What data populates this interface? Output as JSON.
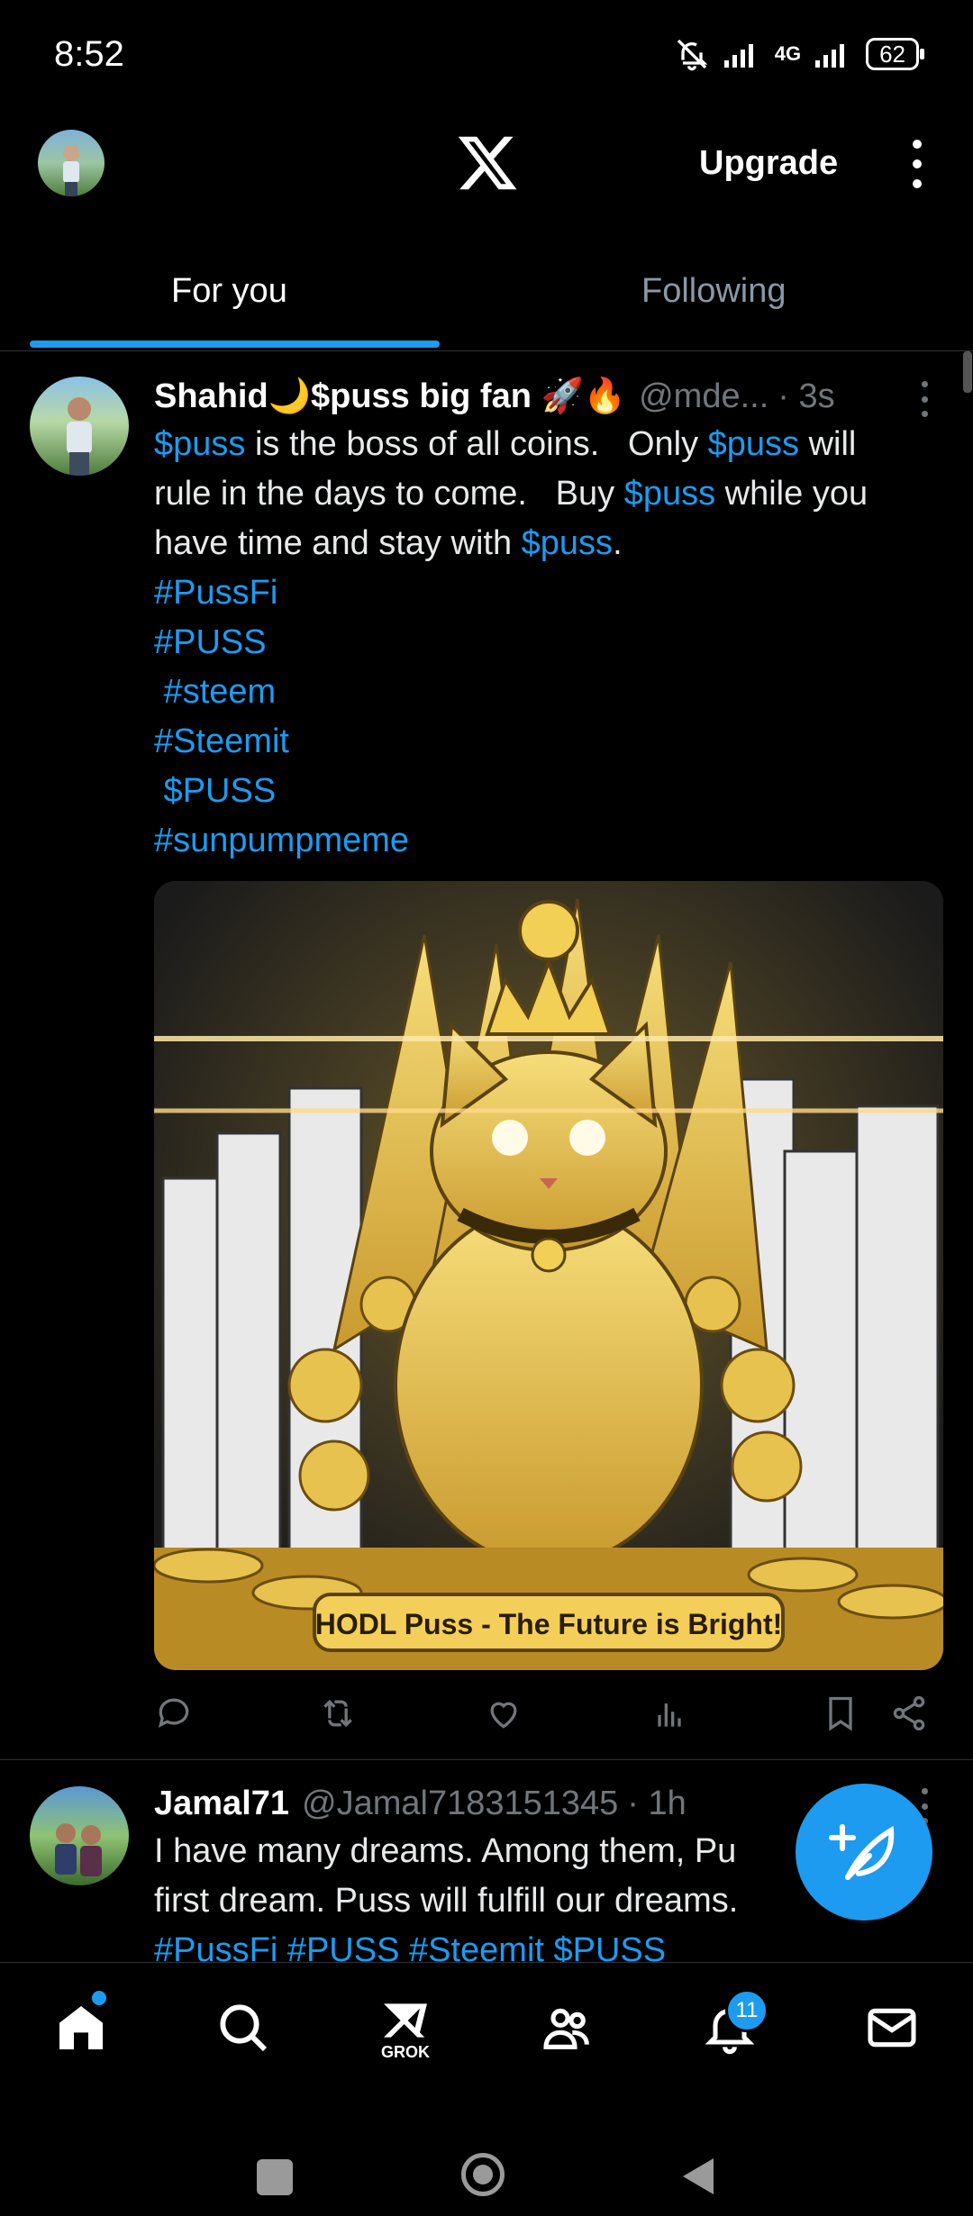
{
  "status_bar": {
    "time": "8:52",
    "network": "4G",
    "battery": "62"
  },
  "header": {
    "upgrade_label": "Upgrade"
  },
  "tabs": [
    {
      "label": "For you",
      "selected": true
    },
    {
      "label": "Following",
      "selected": false
    }
  ],
  "tweets": [
    {
      "name": "Shahid🌙$puss big fan 🚀🔥",
      "handle": "@mde...",
      "time": "· 3s",
      "lines": [
        {
          "parts": [
            {
              "t": "$puss",
              "link": true
            },
            {
              "t": " is the boss of all coins.   Only ",
              "link": false
            },
            {
              "t": "$puss",
              "link": true
            },
            {
              "t": " will",
              "link": false
            }
          ]
        },
        {
          "parts": [
            {
              "t": "rule in the days to come.   Buy ",
              "link": false
            },
            {
              "t": "$puss",
              "link": true
            },
            {
              "t": " while you",
              "link": false
            }
          ]
        },
        {
          "parts": [
            {
              "t": "have time and stay with ",
              "link": false
            },
            {
              "t": "$puss",
              "link": true
            },
            {
              "t": ".",
              "link": false
            }
          ]
        },
        {
          "parts": [
            {
              "t": "#PussFi",
              "link": true
            }
          ]
        },
        {
          "parts": [
            {
              "t": "#PUSS",
              "link": true
            }
          ]
        },
        {
          "parts": [
            {
              "t": " #steem",
              "link": true
            }
          ]
        },
        {
          "parts": [
            {
              "t": "#Steemit",
              "link": true
            }
          ]
        },
        {
          "parts": [
            {
              "t": " $PUSS",
              "link": true
            }
          ]
        },
        {
          "parts": [
            {
              "t": "#sunpumpmeme",
              "link": true
            }
          ]
        }
      ],
      "media_caption": "HODL Puss - The Future is Bright!"
    },
    {
      "name": "Jamal71",
      "handle": "@Jamal7183151345",
      "time": "· 1h",
      "lines": [
        {
          "parts": [
            {
              "t": "I have many dreams. Among them, Pu",
              "link": false
            }
          ]
        },
        {
          "parts": [
            {
              "t": "first dream. Puss will fulfill our dreams.",
              "link": false
            }
          ]
        },
        {
          "parts": [
            {
              "t": "#PussFi #PUSS #Steemit $PUSS",
              "link": true
            }
          ]
        }
      ]
    }
  ],
  "bottom_nav": {
    "grok_label": "GROK",
    "notifications_count": "11"
  },
  "colors": {
    "accent": "#1d9bf0",
    "background": "#000000",
    "muted": "#71767b"
  }
}
